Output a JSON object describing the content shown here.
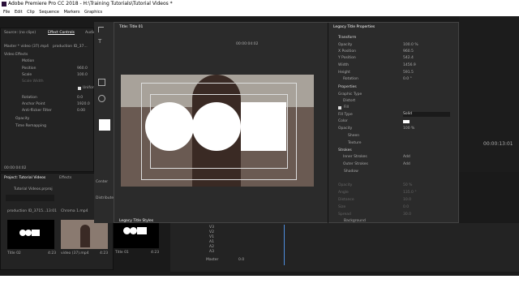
{
  "window": {
    "title": "Adobe Premiere Pro CC 2018 - H:\\Training Tutorials\\Tutorial Videos *"
  },
  "menu": [
    "File",
    "Edit",
    "Clip",
    "Sequence",
    "Markers",
    "Graphics"
  ],
  "source_panel": {
    "tabs": [
      "Source: (no clips)",
      "Effect Controls",
      "Audio"
    ],
    "master": "Master * video (37).mp4",
    "clip": "production ID_37...",
    "video_effects": "Video Effects",
    "motion": "Motion",
    "rows": [
      {
        "label": "Position",
        "value": "960.0"
      },
      {
        "label": "Scale",
        "value": "100.0"
      },
      {
        "label": "Scale Width",
        "value": ""
      },
      {
        "label": "",
        "value": "Uniform"
      },
      {
        "label": "Rotation",
        "value": "0.0"
      },
      {
        "label": "Anchor Point",
        "value": "1920.0"
      },
      {
        "label": "Anti-flicker Filter",
        "value": "0.00"
      }
    ],
    "opacity": "Opacity",
    "time_remap": "Time Remapping",
    "timecode": "00:00:04:02"
  },
  "project_panel": {
    "tab": "Project: Tutorial Videos",
    "effects_tab": "Effects",
    "file": "Tutorial Videos.prproj",
    "items": [
      {
        "name": "production ID_3715...",
        "duration": "13:01"
      },
      {
        "name": "Chroma 1.mp4",
        "duration": ""
      },
      {
        "name": "Title 02",
        "duration": "4:23"
      },
      {
        "name": "video (37).mp4",
        "duration": "4:23"
      },
      {
        "name": "Title 01",
        "duration": "4:23"
      }
    ]
  },
  "tools": {
    "center": "Center",
    "distribute": "Distribute"
  },
  "title_dialog": {
    "title": "Title: Title 01",
    "timecode": "00:00:04:02",
    "styles_tab": "Legacy Title Styles"
  },
  "properties": {
    "header": "Legacy Title Properties",
    "sections": {
      "transform": "Transform",
      "properties": "Properties",
      "strokes": "Strokes"
    },
    "items": [
      {
        "label": "Opacity",
        "value": "100.0 %"
      },
      {
        "label": "X Position",
        "value": "960.5"
      },
      {
        "label": "Y Position",
        "value": "542.4"
      },
      {
        "label": "Width",
        "value": "1456.9"
      },
      {
        "label": "Height",
        "value": "591.5"
      },
      {
        "label": "Rotation",
        "value": "0.0 °"
      },
      {
        "label": "Graphic Type",
        "value": ""
      },
      {
        "label": "Distort",
        "value": ""
      },
      {
        "label": "Fill",
        "value": ""
      },
      {
        "label": "Fill Type",
        "value": "Solid"
      },
      {
        "label": "Color",
        "value": ""
      },
      {
        "label": "Opacity",
        "value": "100 %"
      },
      {
        "label": "Sheen",
        "value": ""
      },
      {
        "label": "Texture",
        "value": ""
      },
      {
        "label": "Inner Strokes",
        "value": "Add"
      },
      {
        "label": "Outer Strokes",
        "value": "Add"
      },
      {
        "label": "Shadow",
        "value": ""
      },
      {
        "label": "Opacity",
        "value": "50 %"
      },
      {
        "label": "Angle",
        "value": "135.0 °"
      },
      {
        "label": "Distance",
        "value": "10.0"
      },
      {
        "label": "Size",
        "value": "0.0"
      },
      {
        "label": "Spread",
        "value": "30.0"
      },
      {
        "label": "Background",
        "value": ""
      }
    ]
  },
  "program": {
    "timecode": "00:00:13:01"
  },
  "timeline": {
    "tracks": [
      "V3",
      "V2",
      "V1",
      "A1",
      "A2",
      "A3"
    ],
    "master": "Master",
    "master_value": "0.0"
  }
}
